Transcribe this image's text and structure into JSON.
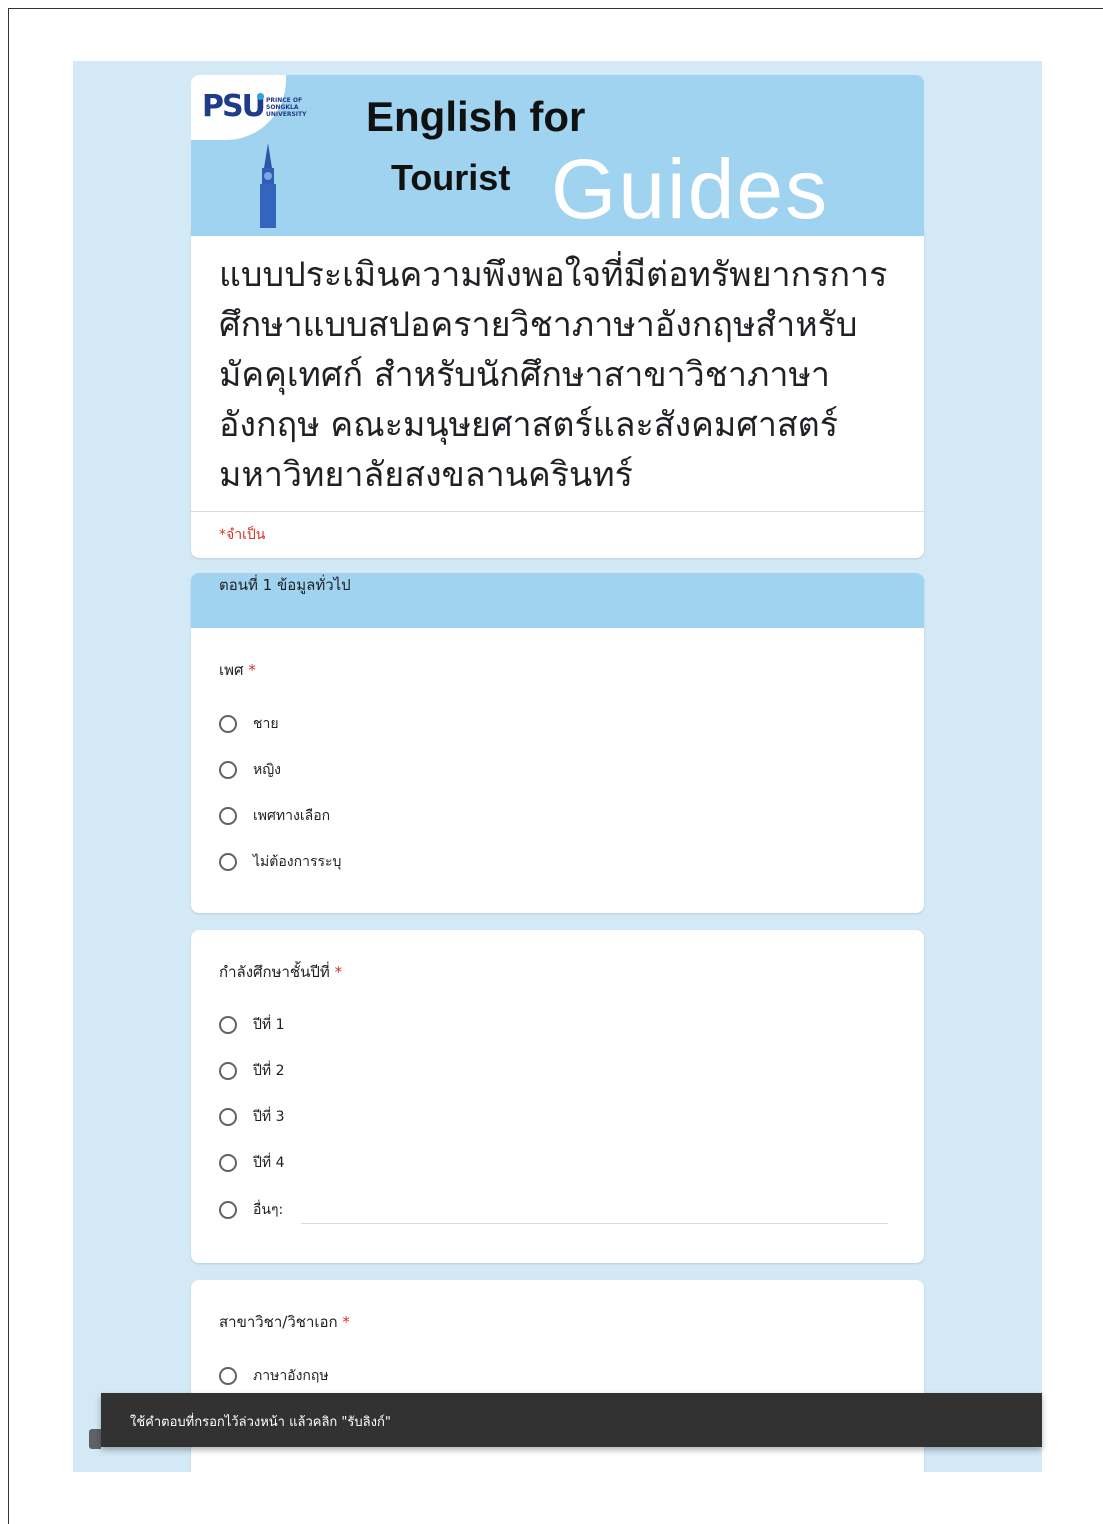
{
  "banner": {
    "logo_mark": "PSU",
    "logo_subtext": "PRINCE OF SONGKLA UNIVERSITY",
    "line1": "English for",
    "line2": "Tourist",
    "line3": "Guides"
  },
  "form": {
    "title": "แบบประเมินความพึงพอใจที่มีต่อทรัพยากรการศึกษาแบบสปอครายวิชาภาษาอังกฤษสำหรับมัคคุเทศก์ สำหรับนักศึกษาสาขาวิชาภาษาอังกฤษ คณะมนุษยศาสตร์และสังคมศาสตร์ มหาวิทยาลัยสงขลานครินทร์",
    "required_note": "*จำเป็น"
  },
  "section": {
    "header": "ตอนที่ 1 ข้อมูลทั่วไป"
  },
  "questions": [
    {
      "label": "เพศ",
      "required_mark": "*",
      "options": [
        "ชาย",
        "หญิง",
        "เพศทางเลือก",
        "ไม่ต้องการระบุ"
      ]
    },
    {
      "label": "กำลังศึกษาชั้นปีที่",
      "required_mark": "*",
      "options": [
        "ปีที่ 1",
        "ปีที่ 2",
        "ปีที่ 3",
        "ปีที่ 4",
        "อื่นๆ:"
      ]
    },
    {
      "label": "สาขาวิชา/วิชาเอก",
      "required_mark": "*",
      "options": [
        "ภาษาอังกฤษ"
      ]
    }
  ],
  "snackbar": {
    "text": "ใช้คำตอบที่กรอกไว้ล่วงหน้า แล้วคลิก \"รับลิงก์\""
  },
  "colors": {
    "accent": "#9fd3ef",
    "background": "#d3e9f5",
    "required": "#d93025"
  }
}
